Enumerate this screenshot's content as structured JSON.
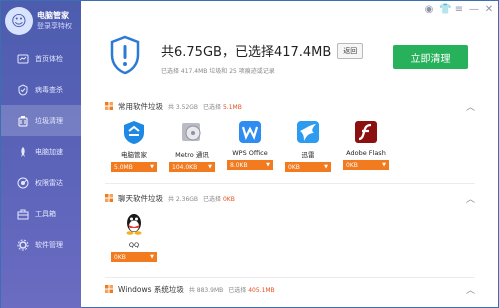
{
  "sidebar": {
    "title": "电脑管家",
    "subtitle": "登录享特权",
    "items": [
      {
        "label": "首页体检",
        "icon": "home-icon"
      },
      {
        "label": "病毒查杀",
        "icon": "virus-icon"
      },
      {
        "label": "垃圾清理",
        "icon": "broom-icon",
        "active": true
      },
      {
        "label": "电脑加速",
        "icon": "rocket-icon"
      },
      {
        "label": "权限雷达",
        "icon": "radar-icon"
      },
      {
        "label": "工具箱",
        "icon": "toolbox-icon"
      },
      {
        "label": "软件管理",
        "icon": "gear-icon"
      }
    ]
  },
  "summary": {
    "title": "共6.75GB，已选择417.4MB",
    "back_label": "返回",
    "subtitle": "已选择 417.4MB 垃圾和 25 项痕迹或记录",
    "clean_label": "立即清理"
  },
  "sections": [
    {
      "title": "常用软件垃圾",
      "size": "共 3.52GB",
      "selected_prefix": "已选择",
      "selected": "5.1MB",
      "apps": [
        {
          "name": "电脑管家",
          "size": "5.0MB",
          "icon": "tencent-pc-manager-icon"
        },
        {
          "name": "Metro 通讯",
          "size": "104.0KB",
          "icon": "metro-icon"
        },
        {
          "name": "WPS Office",
          "size": "8.0KB",
          "icon": "wps-icon"
        },
        {
          "name": "迅雷",
          "size": "0KB",
          "icon": "thunder-icon"
        },
        {
          "name": "Adobe Flash",
          "size": "0KB",
          "icon": "flash-icon"
        }
      ]
    },
    {
      "title": "聊天软件垃圾",
      "size": "共 2.36GB",
      "selected_prefix": "已选择",
      "selected": "0KB",
      "apps": [
        {
          "name": "QQ",
          "size": "0KB",
          "icon": "qq-icon"
        }
      ]
    },
    {
      "title": "Windows 系统垃圾",
      "size": "共 883.9MB",
      "selected_prefix": "已选择",
      "selected": "405.1MB",
      "apps": []
    }
  ],
  "colors": {
    "sidebar": "#5a63b8",
    "accent_green": "#27b15b",
    "badge_orange": "#f27a1f",
    "selected_red": "#e8501e"
  }
}
